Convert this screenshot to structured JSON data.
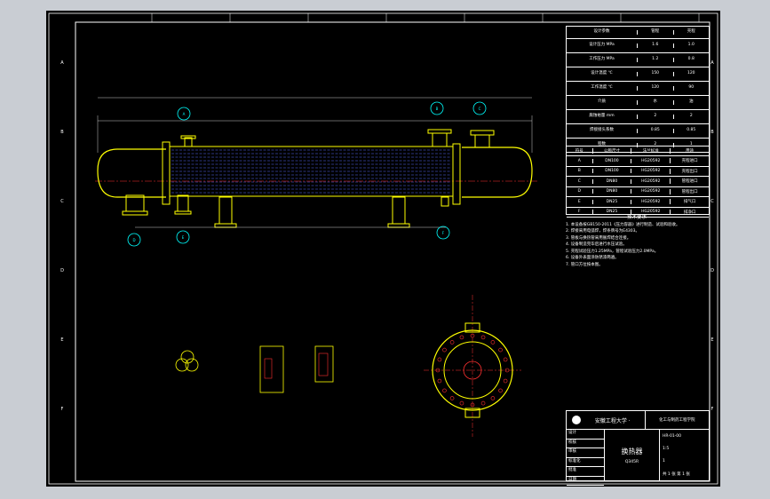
{
  "drawing": {
    "title": "换热器",
    "school": "安徽工程大学 ·",
    "company_note": "化工与制药工程学院",
    "drawing_no": "HR-01-00",
    "scale": "1:5",
    "sheet": "共 1 张  第 1 张",
    "material": "Q345R",
    "quantity": "1"
  },
  "border_marks": {
    "left": [
      "A",
      "B",
      "C",
      "D",
      "E",
      "F"
    ],
    "top": [
      "1",
      "2",
      "3",
      "4",
      "5",
      "6",
      "7",
      "8"
    ]
  },
  "nozzles": {
    "labels": [
      "A",
      "B",
      "C",
      "D",
      "E",
      "F"
    ]
  },
  "specs_header": [
    "设计参数",
    "管程",
    "壳程"
  ],
  "specs_rows": [
    [
      "设计压力 MPa",
      "1.6",
      "1.0"
    ],
    [
      "工作压力 MPa",
      "1.2",
      "0.8"
    ],
    [
      "设计温度 ℃",
      "150",
      "120"
    ],
    [
      "工作温度 ℃",
      "120",
      "90"
    ],
    [
      "介质",
      "水",
      "油"
    ],
    [
      "腐蚀裕量 mm",
      "2",
      "2"
    ],
    [
      "焊接接头系数",
      "0.85",
      "0.85"
    ],
    [
      "程数",
      "2",
      "1"
    ]
  ],
  "nozzle_table_header": [
    "符号",
    "公称尺寸",
    "法兰标准",
    "用途"
  ],
  "nozzle_table_rows": [
    [
      "A",
      "DN100",
      "HG20592",
      "壳程进口"
    ],
    [
      "B",
      "DN100",
      "HG20592",
      "壳程出口"
    ],
    [
      "C",
      "DN80",
      "HG20592",
      "管程进口"
    ],
    [
      "D",
      "DN80",
      "HG20592",
      "管程出口"
    ],
    [
      "E",
      "DN25",
      "HG20592",
      "排气口"
    ],
    [
      "F",
      "DN25",
      "HG20592",
      "排净口"
    ]
  ],
  "tech_requirements_title": "技术要求",
  "tech_requirements": [
    "1. 本设备按GB150-2011《压力容器》进行制造、试验和验收。",
    "2. 焊接采用电弧焊，焊条牌号为E4303。",
    "3. 管板与换热管采用胀焊结合连接。",
    "4. 设备制造完毕后进行水压试验。",
    "5. 壳程试验压力1.25MPa，管程试验压力2.0MPa。",
    "6. 设备外表面涂防锈漆两遍。",
    "7. 管口方位按本图。"
  ],
  "title_block_rows": [
    "设计",
    "校核",
    "审核",
    "标准化",
    "批准",
    "日期"
  ],
  "colors": {
    "background": "#000000",
    "frame": "#ffffff",
    "vessel": "#ffff00",
    "tubes": "#5b6cff",
    "axis": "#ff2020",
    "labels": "#00ffff"
  }
}
